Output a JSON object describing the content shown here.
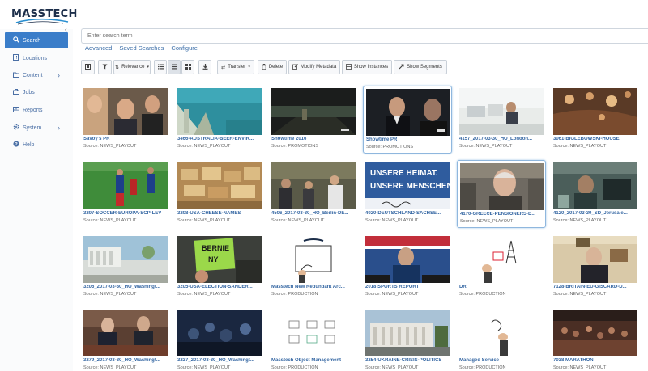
{
  "logo": {
    "text": "MASSTECH"
  },
  "sidebar": {
    "items": [
      {
        "label": "Search",
        "icon": "search-icon",
        "active": true
      },
      {
        "label": "Locations",
        "icon": "building-icon"
      },
      {
        "label": "Content",
        "icon": "folder-icon",
        "has_children": true
      },
      {
        "label": "Jobs",
        "icon": "briefcase-icon"
      },
      {
        "label": "Reports",
        "icon": "chart-icon"
      },
      {
        "label": "System",
        "icon": "gear-icon",
        "has_children": true
      },
      {
        "label": "Help",
        "icon": "help-icon"
      }
    ]
  },
  "search": {
    "placeholder": "Enter search term",
    "links": [
      "Advanced",
      "Saved Searches",
      "Configure"
    ]
  },
  "toolbar": {
    "sort_label": "Relevance",
    "transfer_label": "Transfer",
    "delete_label": "Delete",
    "modify_metadata_label": "Modify Metadata",
    "show_instances_label": "Show Instances",
    "show_segments_label": "Show Segments"
  },
  "results": [
    {
      "title": "Savoy's PR",
      "source": "Source: NEWS_PLAYOUT"
    },
    {
      "title": "3466-AUSTRALIA-BEER-ENVIR...",
      "source": "Source: NEWS_PLAYOUT"
    },
    {
      "title": "Showtime 2016",
      "source": "Source: PROMOTIONS"
    },
    {
      "title": "Showtime PR",
      "source": "Source: PROMOTIONS"
    },
    {
      "title": "4157_2017-03-30_HO_London...",
      "source": "Source: NEWS_PLAYOUT"
    },
    {
      "title": "3061-BIGLEBOWSKI-HOUSE",
      "source": "Source: NEWS_PLAYOUT"
    },
    {
      "title": "3207-SOCCER-EUROPA-SCP-LEV",
      "source": "Source: NEWS_PLAYOUT"
    },
    {
      "title": "3208-USA-CHEESE-NAMES",
      "source": "Source: NEWS_PLAYOUT"
    },
    {
      "title": "4506_2017-03-30_HO_Berlin-DE...",
      "source": "Source: NEWS_PLAYOUT"
    },
    {
      "title": "4020-DEUTSCHLAND-SACHSE...",
      "source": "Source: NEWS_PLAYOUT",
      "thumb_text": [
        "UNSERE HEIMAT.",
        "UNSERE MENSCHEN."
      ]
    },
    {
      "title": "4170-GREECE-PENSIONERS-D...",
      "source": "Source: NEWS_PLAYOUT"
    },
    {
      "title": "4120_2017-03-30_SD_Jerusale...",
      "source": "Source: NEWS_PLAYOUT"
    },
    {
      "title": "3206_2017-03-30_HO_Washingt...",
      "source": "Source: NEWS_PLAYOUT"
    },
    {
      "title": "3205-USA-ELECTION-SANDER...",
      "source": "Source: NEWS_PLAYOUT",
      "thumb_text": [
        "BERNIE",
        "NY"
      ]
    },
    {
      "title": "Masstech New Redundant Arc...",
      "source": "Source: PRODUCTION"
    },
    {
      "title": "2018 SPORTS REPORT",
      "source": "Source: NEWS_PLAYOUT"
    },
    {
      "title": "DR",
      "source": "Source: PRODUCTION"
    },
    {
      "title": "7128-BRITAIN-EU-GISCARD-D...",
      "source": "Source: NEWS_PLAYOUT"
    },
    {
      "title": "3279_2017-03-30_HO_Washingt...",
      "source": "Source: NEWS_PLAYOUT"
    },
    {
      "title": "3237_2017-03-30_HO_Washingt...",
      "source": "Source: NEWS_PLAYOUT"
    },
    {
      "title": "Masstech Object Management",
      "source": "Source: PRODUCTION"
    },
    {
      "title": "3254-UKRAINE-CRISIS-POLITICS",
      "source": "Source: NEWS_PLAYOUT"
    },
    {
      "title": "Managed Service",
      "source": "Source: PRODUCTION"
    },
    {
      "title": "7038 MARATHON",
      "source": "Source: NEWS_PLAYOUT"
    }
  ],
  "colors": {
    "accent": "#3a7dc9",
    "link": "#3567a3",
    "selected_border": "#8fb7de"
  }
}
